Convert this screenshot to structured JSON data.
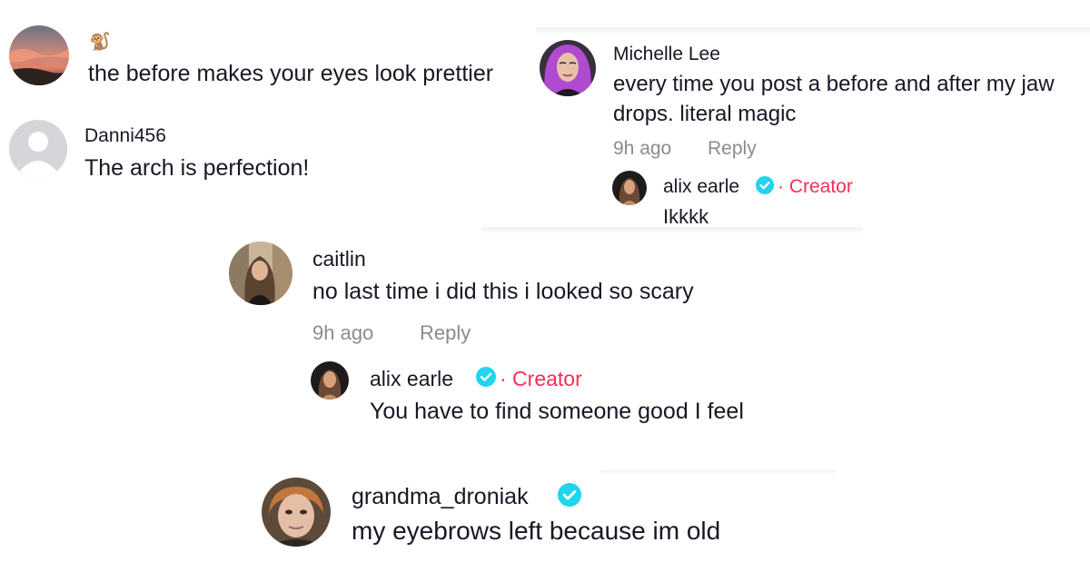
{
  "colors": {
    "username": "#161823",
    "text": "#161823",
    "meta": "#8a8b91",
    "creator": "#fe2c55",
    "verified": "#20d5ec"
  },
  "comments": [
    {
      "id": "monkey",
      "username_icon": "monkey-emoji-icon",
      "username_glyph": "🐒",
      "text": "the before makes your eyes look prettier",
      "avatar_icon": "sunset-avatar"
    },
    {
      "id": "danni",
      "username": "Danni456",
      "text": "The arch is perfection!",
      "avatar_icon": "default-user-avatar"
    },
    {
      "id": "michelle",
      "username": "Michelle Lee",
      "text_lines": [
        "every time you post a before and after my jaw",
        "drops. literal magic"
      ],
      "time": "9h ago",
      "reply_label": "Reply",
      "avatar_icon": "purple-hair-avatar",
      "reply": {
        "username": "alix earle",
        "verified_icon": "verified-badge-icon",
        "creator_label": "· Creator",
        "text": "Ikkkk",
        "avatar_icon": "creator-avatar"
      }
    },
    {
      "id": "caitlin",
      "username": "caitlin",
      "text": "no last time i did this i looked so scary",
      "time": "9h ago",
      "reply_label": "Reply",
      "avatar_icon": "mirror-selfie-avatar",
      "reply": {
        "username": "alix earle",
        "verified_icon": "verified-badge-icon",
        "creator_label": "· Creator",
        "text": "You have to find someone good I feel",
        "avatar_icon": "creator-avatar"
      }
    },
    {
      "id": "grandma",
      "username": "grandma_droniak",
      "verified_icon": "verified-badge-icon",
      "text": "my eyebrows left because im old",
      "avatar_icon": "grandma-avatar"
    }
  ]
}
